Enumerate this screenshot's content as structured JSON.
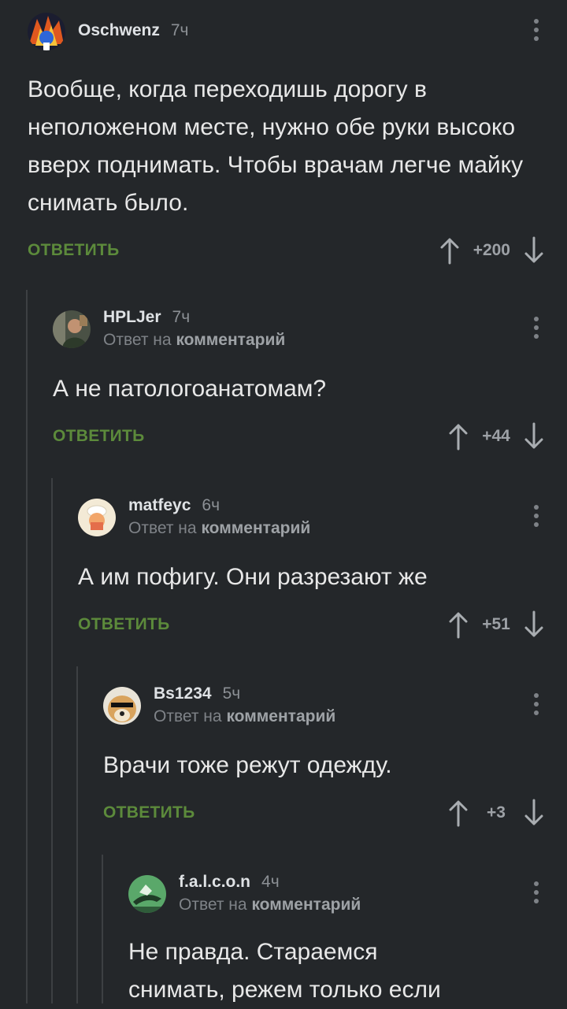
{
  "reply_prefix": "Ответ на",
  "reply_target": "комментарий",
  "reply_button": "ОТВЕТИТЬ",
  "colors": {
    "background": "#24272a",
    "accent": "#5c8a3b",
    "thread_line": "#3d4043"
  },
  "icons": {
    "up": "arrow-up-icon",
    "down": "arrow-down-icon",
    "menu": "more-vertical-icon"
  },
  "comments": [
    {
      "username": "Oschwenz",
      "time": "7ч",
      "text": "Вообще, когда переходишь дорогу в неположеном месте, нужно обе руки высоко вверх поднимать. Чтобы врачам легче майку снимать было.",
      "rating": "+200"
    },
    {
      "username": "HPLJer",
      "time": "7ч",
      "text": "А не патологоанатомам?",
      "rating": "+44"
    },
    {
      "username": "matfeyc",
      "time": "6ч",
      "text": "А им пофигу. Они разрезают же",
      "rating": "+51"
    },
    {
      "username": "Bs1234",
      "time": "5ч",
      "text": "Врачи тоже режут одежду.",
      "rating": "+3"
    },
    {
      "username": "f.a.l.c.o.n",
      "time": "4ч",
      "text": "Не правда. Стараемся снимать, режем только если"
    }
  ]
}
